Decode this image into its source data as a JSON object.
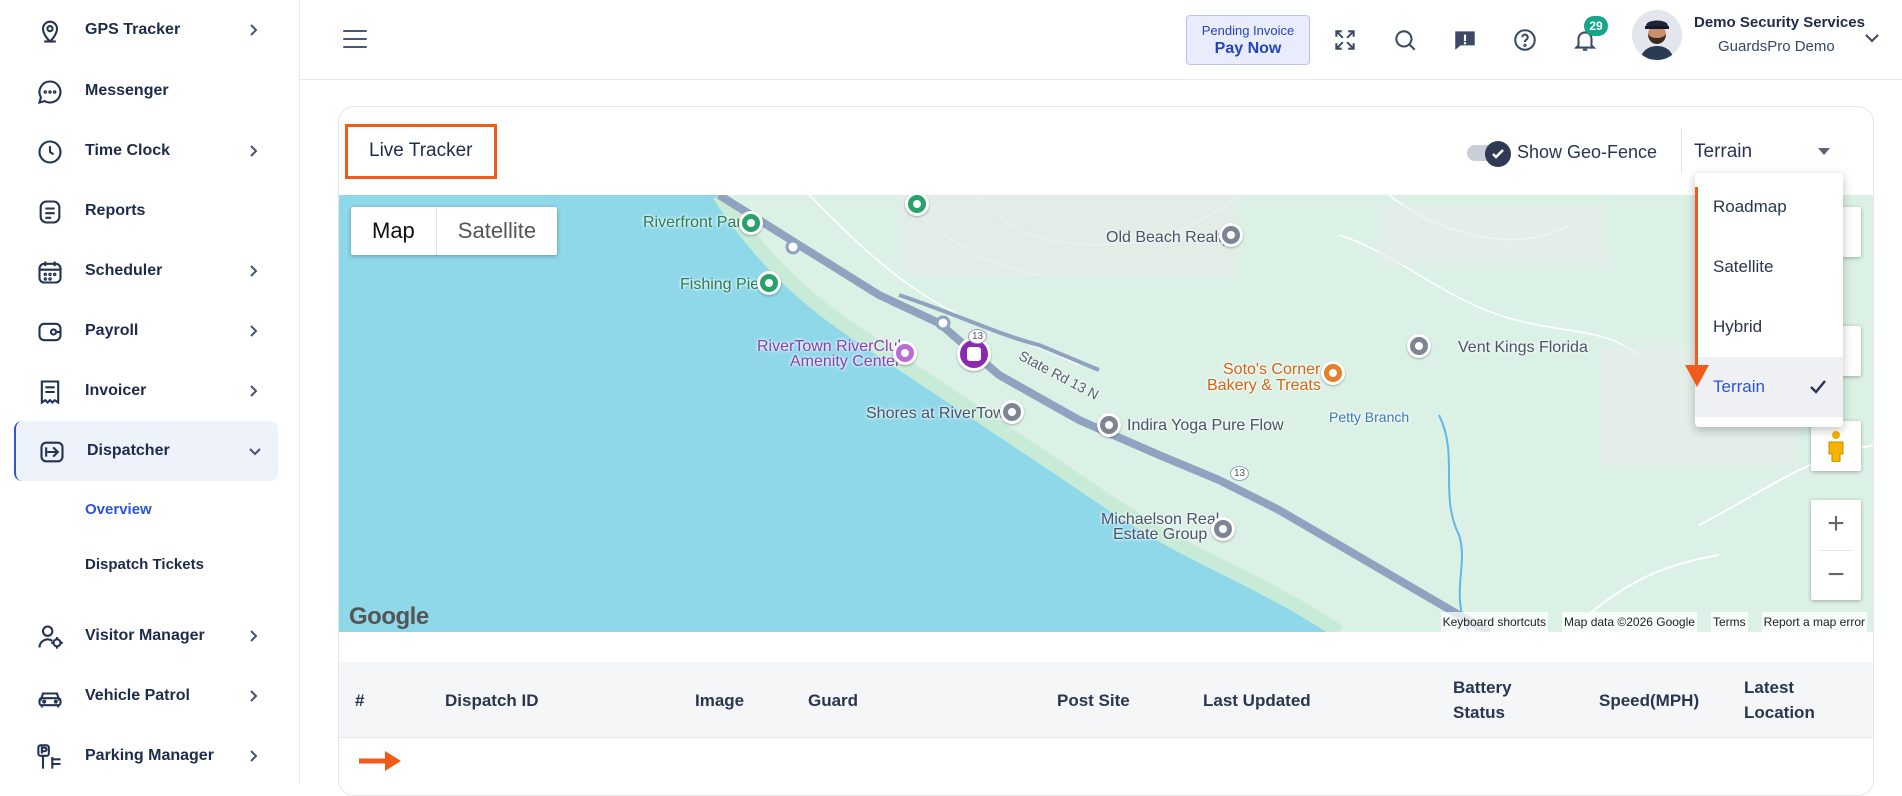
{
  "sidebar": {
    "items": [
      {
        "label": "GPS Tracker",
        "icon": "location-pin-icon",
        "chevron": true
      },
      {
        "label": "Messenger",
        "icon": "chat-bubble-icon",
        "chevron": false
      },
      {
        "label": "Time Clock",
        "icon": "clock-icon",
        "chevron": true
      },
      {
        "label": "Reports",
        "icon": "document-icon",
        "chevron": false
      },
      {
        "label": "Scheduler",
        "icon": "calendar-icon",
        "chevron": true
      },
      {
        "label": "Payroll",
        "icon": "wallet-icon",
        "chevron": true
      },
      {
        "label": "Invoicer",
        "icon": "receipt-icon",
        "chevron": true
      },
      {
        "label": "Dispatcher",
        "icon": "dispatch-icon",
        "chevron": true,
        "expanded": true
      },
      {
        "label": "Visitor Manager",
        "icon": "visitor-icon",
        "chevron": true
      },
      {
        "label": "Vehicle Patrol",
        "icon": "car-icon",
        "chevron": true
      },
      {
        "label": "Parking Manager",
        "icon": "parking-icon",
        "chevron": true
      }
    ],
    "dispatcher_sub": [
      {
        "label": "Overview",
        "active": true
      },
      {
        "label": "Dispatch Tickets",
        "active": false
      }
    ]
  },
  "header": {
    "pending_line1": "Pending Invoice",
    "pending_line2": "Pay Now",
    "notification_count": "29",
    "user_name": "Demo Security Services",
    "user_org": "GuardsPro Demo"
  },
  "tracker": {
    "title": "Live Tracker",
    "geofence_label": "Show Geo-Fence",
    "geofence_on": true,
    "map_style_selected": "Terrain",
    "map_style_options": [
      "Roadmap",
      "Satellite",
      "Hybrid",
      "Terrain"
    ]
  },
  "map": {
    "type_buttons": [
      "Map",
      "Satellite"
    ],
    "pois": {
      "riverfront_park": "Riverfront Park",
      "fishing_pier": "Fishing Pier",
      "rivertown_club_1": "RiverTown RiverClub",
      "rivertown_club_2": "Amenity Center",
      "shores": "Shores at RiverTown",
      "old_beach": "Old Beach Realty",
      "vent_kings": "Vent Kings Florida",
      "soto_1": "Soto's Corner",
      "soto_2": "Bakery & Treats",
      "petty_branch": "Petty Branch",
      "indira": "Indira Yoga Pure Flow",
      "michaelson_1": "Michaelson Real",
      "michaelson_2": "Estate Group",
      "road_name": "State Rd 13 N",
      "route_shield": "13"
    },
    "google_logo": "Google",
    "attribution": [
      "Keyboard shortcuts",
      "Map data ©2026 Google",
      "Terms",
      "Report a map error"
    ]
  },
  "table": {
    "headers": [
      "#",
      "Dispatch ID",
      "Image",
      "Guard",
      "Post Site",
      "Last Updated",
      "Battery Status",
      "Speed(MPH)",
      "Latest Location"
    ]
  },
  "colors": {
    "accent": "#2b54d6",
    "annotation": "#f05a1a",
    "badge": "#17a589"
  }
}
